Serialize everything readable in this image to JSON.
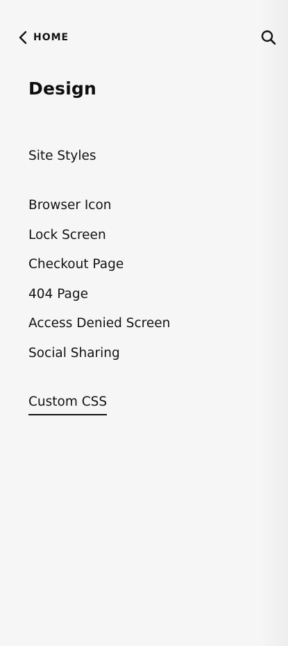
{
  "header": {
    "back_label": "HOME"
  },
  "page": {
    "title": "Design"
  },
  "menu": {
    "site_styles": "Site Styles",
    "items": [
      "Browser Icon",
      "Lock Screen",
      "Checkout Page",
      "404 Page",
      "Access Denied Screen",
      "Social Sharing"
    ],
    "custom_css": "Custom CSS"
  },
  "icons": {
    "back": "chevron-left-icon",
    "search": "search-icon"
  },
  "colors": {
    "background": "#f6f6f6",
    "text": "#0e0e0e"
  }
}
